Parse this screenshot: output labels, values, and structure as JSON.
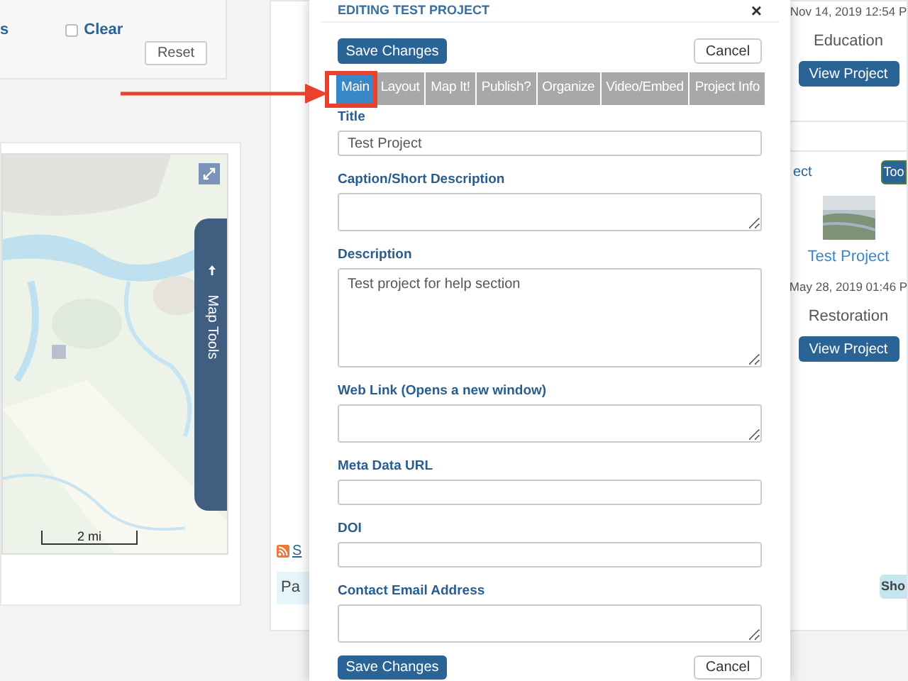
{
  "filter_panel": {
    "partial_label": "s",
    "clear_checkbox": {
      "label": "Clear",
      "checked": false
    },
    "reset_button": "Reset"
  },
  "map": {
    "kind": "picture",
    "map_tools_label": "Map Tools",
    "scale_label": "2 mi"
  },
  "feed": {
    "rss_link": "S",
    "notice": "Pa",
    "show_button": "Sho"
  },
  "projects": [
    {
      "date": "Nov 14, 2019 12:54 P",
      "category": "Education",
      "button": "View Project"
    },
    {
      "title_partial": "ect",
      "tools_button": "Too",
      "title": "Test Project",
      "date": "May 28, 2019 01:46 P",
      "category": "Restoration",
      "button": "View Project"
    }
  ],
  "modal": {
    "title": "EDITING TEST PROJECT",
    "close": "×",
    "top_actions": {
      "save_button": "Save Changes",
      "cancel_button": "Cancel"
    },
    "tabs": [
      {
        "label": "Main",
        "selected": true
      },
      {
        "label": "Layout",
        "selected": false
      },
      {
        "label": "Map It!",
        "selected": false
      },
      {
        "label": "Publish?",
        "selected": false
      },
      {
        "label": "Organize",
        "selected": false
      },
      {
        "label": "Video/Embed",
        "selected": false
      },
      {
        "label": "Project Info",
        "selected": false
      }
    ],
    "fields": [
      {
        "label": "Title",
        "kind": "input",
        "value": "Test Project"
      },
      {
        "label": "Caption/Short Description",
        "kind": "textarea"
      },
      {
        "label": "Description",
        "kind": "tall_textarea",
        "value": "Test project for help section"
      },
      {
        "label": "Web Link (Opens a new window)",
        "kind": "textarea"
      },
      {
        "label": "Meta Data URL",
        "kind": "input"
      },
      {
        "label": "DOI",
        "kind": "input"
      },
      {
        "label": "Contact Email Address",
        "kind": "textarea"
      }
    ],
    "bottom_actions": {
      "save_button": "Save Changes",
      "cancel_button": "Cancel"
    }
  }
}
